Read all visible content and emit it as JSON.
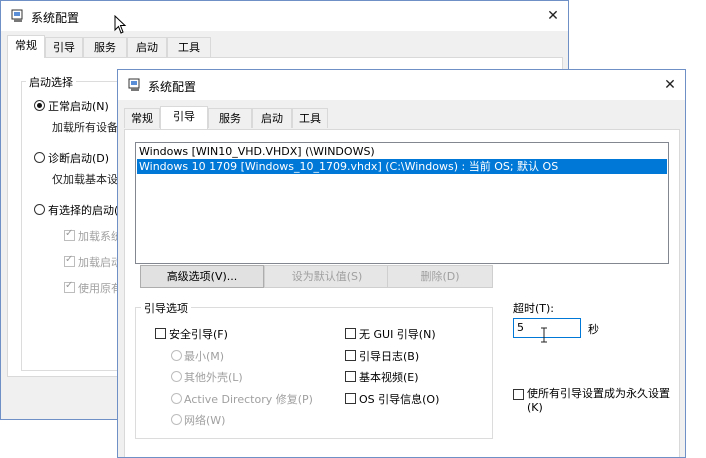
{
  "back_window": {
    "title": "系统配置",
    "tabs": [
      "常规",
      "引导",
      "服务",
      "启动",
      "工具"
    ],
    "group_title": "启动选择",
    "normal": "正常启动(N)",
    "normal_desc": "加载所有设备",
    "diag": "诊断启动(D)",
    "diag_desc": "仅加载基本设",
    "selective": "有选择的启动(S",
    "opt1": "加载系统",
    "opt2": "加载启动",
    "opt3": "使用原有"
  },
  "front_window": {
    "title": "系统配置",
    "tabs": [
      "常规",
      "引导",
      "服务",
      "启动",
      "工具"
    ],
    "boot_list": [
      "Windows [WIN10_VHD.VHDX] (\\WINDOWS)",
      "Windows 10 1709 [Windows_10_1709.vhdx] (C:\\Windows) : 当前 OS; 默认 OS"
    ],
    "buttons": {
      "advanced": "高级选项(V)...",
      "set_default": "设为默认值(S)",
      "delete": "删除(D)"
    },
    "boot_options": {
      "title": "引导选项",
      "safe_boot": "安全引导(F)",
      "minimal": "最小(M)",
      "alternate_shell": "其他外壳(L)",
      "active_directory": "Active Directory 修复(P)",
      "network": "网络(W)",
      "no_gui": "无 GUI 引导(N)",
      "boot_log": "引导日志(B)",
      "base_video": "基本视频(E)",
      "os_info": "OS 引导信息(O)"
    },
    "timeout": {
      "label": "超时(T):",
      "value": "5",
      "unit": "秒"
    },
    "permanent": "使所有引导设置成为永久设置(K)"
  }
}
